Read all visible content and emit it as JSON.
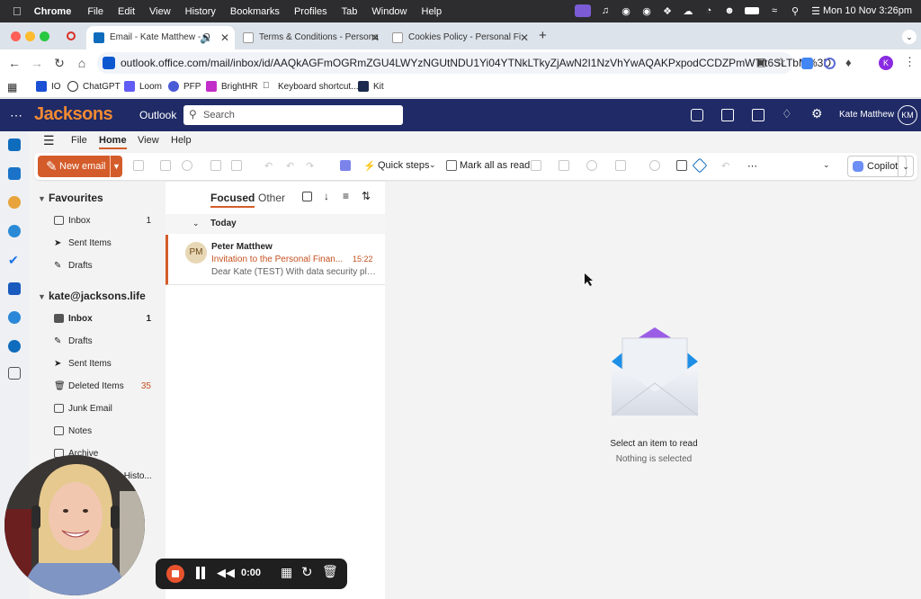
{
  "menubar": {
    "app": "Chrome",
    "items": [
      "File",
      "Edit",
      "View",
      "History",
      "Bookmarks",
      "Profiles",
      "Tab",
      "Window",
      "Help"
    ],
    "clock": "Mon 10 Nov  3:26pm"
  },
  "tabs": [
    {
      "label": "Email - Kate Matthew - O",
      "active": true
    },
    {
      "label": "Terms & Conditions - Persona",
      "active": false
    },
    {
      "label": "Cookies Policy - Personal Fi",
      "active": false
    }
  ],
  "address": {
    "url": "outlook.office.com/mail/inbox/id/AAQkAGFmOGRmZGU4LWYzNGUtNDU1Yi04YTNkLTkyZjAwN2I1NzVhYwAQAKPxpodCCDZPmWTft6SLTbM%3D"
  },
  "bookmarks": [
    "IO",
    "ChatGPT",
    "Loom",
    "PFP",
    "BrightHR",
    "Keyboard shortcut...",
    "Kit"
  ],
  "outlook": {
    "brand": "Jacksons",
    "app_name": "Outlook",
    "search_placeholder": "Search",
    "user_name": "Kate Matthew",
    "user_initials": "KM"
  },
  "ribbon": {
    "tabs": [
      "File",
      "Home",
      "View",
      "Help"
    ],
    "active_tab": "Home",
    "new_email": "New email",
    "quick_steps": "Quick steps",
    "mark_all_read": "Mark all as read",
    "copilot": "Copilot"
  },
  "folders": {
    "favourites_header": "Favourites",
    "favourites": [
      {
        "label": "Inbox",
        "count": "1"
      },
      {
        "label": "Sent Items",
        "count": ""
      },
      {
        "label": "Drafts",
        "count": ""
      }
    ],
    "account_header": "kate@jacksons.life",
    "account": [
      {
        "label": "Inbox",
        "count": "1"
      },
      {
        "label": "Drafts",
        "count": ""
      },
      {
        "label": "Sent Items",
        "count": ""
      },
      {
        "label": "Deleted Items",
        "count": "35"
      },
      {
        "label": "Junk Email",
        "count": ""
      },
      {
        "label": "Notes",
        "count": ""
      },
      {
        "label": "Archive",
        "count": ""
      },
      {
        "label": "Conversation Histo...",
        "count": ""
      }
    ]
  },
  "message_list": {
    "focused": "Focused",
    "other": "Other",
    "group": "Today",
    "messages": [
      {
        "initials": "PM",
        "from": "Peter Matthew",
        "subject": "Invitation to the Personal Finan...",
        "time": "15:22",
        "preview": "Dear Kate (TEST) With data security pla..."
      }
    ]
  },
  "reading_pane": {
    "title": "Select an item to read",
    "subtitle": "Nothing is selected"
  },
  "recorder": {
    "timer": "0:00"
  },
  "colors": {
    "accent": "#d45c2a",
    "header_bg": "#1f2a66",
    "brand": "#f28a32"
  }
}
